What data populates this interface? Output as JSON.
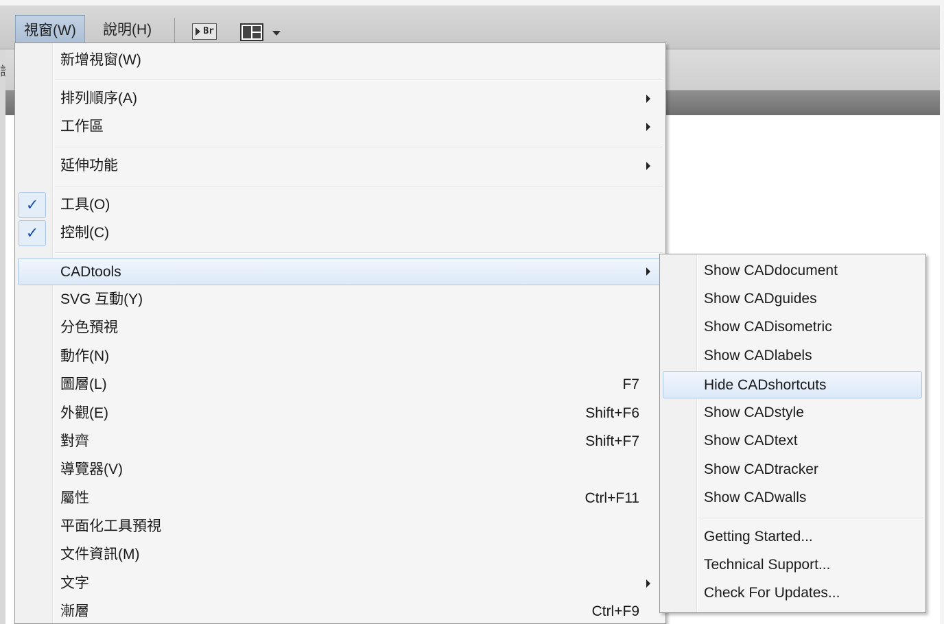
{
  "menubar": {
    "items": [
      {
        "label": "視窗(W)",
        "active": true
      },
      {
        "label": "說明(H)",
        "active": false
      }
    ],
    "bridge_icon_text": "Br",
    "icons": [
      "bridge-icon",
      "workspace-layout-icon",
      "chevron-down-icon"
    ]
  },
  "left_edge_glyph": "設",
  "window_menu": {
    "items": [
      {
        "label": "新增視窗(W)",
        "shortcut": "",
        "submenu": false,
        "checked": false
      },
      {
        "label": "排列順序(A)",
        "shortcut": "",
        "submenu": true,
        "checked": false
      },
      {
        "label": "工作區",
        "shortcut": "",
        "submenu": true,
        "checked": false
      },
      {
        "label": "延伸功能",
        "shortcut": "",
        "submenu": true,
        "checked": false
      },
      {
        "label": "工具(O)",
        "shortcut": "",
        "submenu": false,
        "checked": true
      },
      {
        "label": "控制(C)",
        "shortcut": "",
        "submenu": false,
        "checked": true
      },
      {
        "label": "CADtools",
        "shortcut": "",
        "submenu": true,
        "checked": false,
        "highlighted": true
      },
      {
        "label": "SVG 互動(Y)",
        "shortcut": "",
        "submenu": false,
        "checked": false
      },
      {
        "label": "分色預視",
        "shortcut": "",
        "submenu": false,
        "checked": false
      },
      {
        "label": "動作(N)",
        "shortcut": "",
        "submenu": false,
        "checked": false
      },
      {
        "label": "圖層(L)",
        "shortcut": "F7",
        "submenu": false,
        "checked": false
      },
      {
        "label": "外觀(E)",
        "shortcut": "Shift+F6",
        "submenu": false,
        "checked": false
      },
      {
        "label": "對齊",
        "shortcut": "Shift+F7",
        "submenu": false,
        "checked": false
      },
      {
        "label": "導覽器(V)",
        "shortcut": "",
        "submenu": false,
        "checked": false
      },
      {
        "label": "屬性",
        "shortcut": "Ctrl+F11",
        "submenu": false,
        "checked": false
      },
      {
        "label": "平面化工具預視",
        "shortcut": "",
        "submenu": false,
        "checked": false
      },
      {
        "label": "文件資訊(M)",
        "shortcut": "",
        "submenu": false,
        "checked": false
      },
      {
        "label": "文字",
        "shortcut": "",
        "submenu": true,
        "checked": false
      },
      {
        "label": "漸層",
        "shortcut": "Ctrl+F9",
        "submenu": false,
        "checked": false
      }
    ],
    "check_glyph": "✓"
  },
  "cadtools_submenu": {
    "items": [
      {
        "label": "Show CADdocument"
      },
      {
        "label": "Show CADguides"
      },
      {
        "label": "Show CADisometric"
      },
      {
        "label": "Show CADlabels"
      },
      {
        "label": "Hide CADshortcuts",
        "highlighted": true
      },
      {
        "label": "Show CADstyle"
      },
      {
        "label": "Show CADtext"
      },
      {
        "label": "Show CADtracker"
      },
      {
        "label": "Show CADwalls"
      },
      {
        "label": "Getting Started..."
      },
      {
        "label": "Technical Support..."
      },
      {
        "label": "Check For Updates..."
      }
    ]
  }
}
